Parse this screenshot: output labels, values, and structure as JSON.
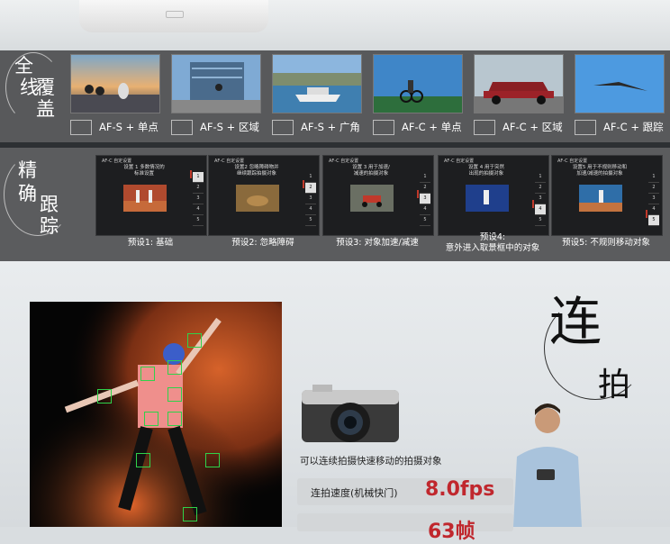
{
  "coverage": {
    "title_chars": [
      "全",
      "线",
      "覆",
      "盖"
    ],
    "items": [
      {
        "label": "AF-S + 单点"
      },
      {
        "label": "AF-S + 区域"
      },
      {
        "label": "AF-S + 广角"
      },
      {
        "label": "AF-C + 单点"
      },
      {
        "label": "AF-C + 区域"
      },
      {
        "label": "AF-C + 跟踪"
      }
    ]
  },
  "precision": {
    "title_chars": [
      "精",
      "确",
      "跟",
      "踪"
    ],
    "screen_header": "AF-C 自定设置",
    "list_numbers": [
      "1",
      "2",
      "3",
      "4",
      "5"
    ],
    "presets": [
      {
        "desc": "设置 1 多数情况的\n标准设置",
        "caption": "预设1: 基础",
        "selected": 0
      },
      {
        "desc": "设置2 忽略障碍物并\n继续跟踪拍摄对象",
        "caption": "预设2: 忽略障碍",
        "selected": 1
      },
      {
        "desc": "设置 3 用于加速/\n减速的拍摄对象",
        "caption": "预设3: 对象加速/减速",
        "selected": 2
      },
      {
        "desc": "设置 4 用于突然\n出现的拍摄对象",
        "caption": "预设4:\n意外进入取景框中的对象",
        "selected": 3
      },
      {
        "desc": "设置5 用于不规则移动和\n加速/减速的拍摄对象",
        "caption": "预设5: 不规则移动对象",
        "selected": 4
      }
    ]
  },
  "continuous": {
    "title_chars": [
      "连",
      "拍"
    ],
    "feature_text": "可以连续拍摄快速移动的拍摄对象",
    "spec_label": "连拍速度(机械快门)",
    "spec_value": "8.0fps",
    "spec_value_2": "63帧"
  },
  "colors": {
    "accent_red": "#c0272d",
    "focus_green": "#2fd24a",
    "band_gray": "#58595b"
  }
}
